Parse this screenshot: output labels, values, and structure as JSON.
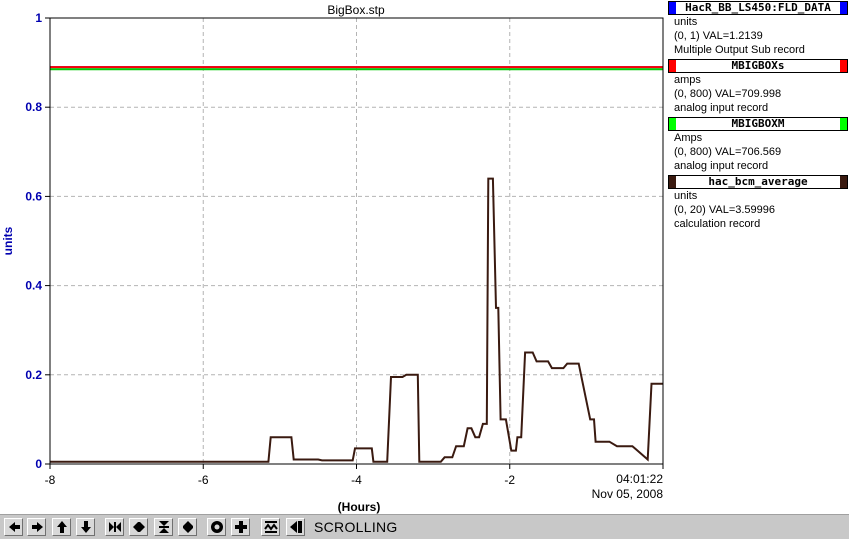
{
  "chart_data": {
    "type": "line",
    "title": "BigBox.stp",
    "ylabel": "units",
    "xlabel": "(Hours)",
    "xlim": [
      -8,
      0
    ],
    "ylim": [
      0,
      1
    ],
    "x_ticks": [
      "-8",
      "-6",
      "-4",
      "-2"
    ],
    "y_ticks": [
      "0",
      "0.2",
      "0.4",
      "0.6",
      "0.8",
      "1"
    ],
    "grid": true,
    "end_time": "04:01:22",
    "end_date": "Nov 05, 2008",
    "series": [
      {
        "name": "HacR_BB_LS450:FLD_DATA",
        "color": "#0000ff",
        "x": [
          -8,
          0
        ],
        "y": [
          0.89,
          0.89
        ]
      },
      {
        "name": "MBIGBOXs",
        "color": "#ff0000",
        "x": [
          -8,
          0
        ],
        "y": [
          0.89,
          0.89
        ]
      },
      {
        "name": "MBIGBOXM",
        "color": "#00cc00",
        "x": [
          -8,
          0
        ],
        "y": [
          0.885,
          0.885
        ]
      },
      {
        "name": "hac_bcm_average",
        "color": "#3a1a10",
        "x": [
          -8,
          -5.15,
          -5.12,
          -4.85,
          -4.82,
          -4.5,
          -4.45,
          -4.05,
          -4.02,
          -3.8,
          -3.78,
          -3.6,
          -3.55,
          -3.4,
          -3.35,
          -3.2,
          -3.18,
          -2.9,
          -2.85,
          -2.75,
          -2.7,
          -2.6,
          -2.55,
          -2.5,
          -2.45,
          -2.4,
          -2.35,
          -2.3,
          -2.28,
          -2.22,
          -2.18,
          -2.15,
          -2.12,
          -2.05,
          -1.98,
          -1.92,
          -1.9,
          -1.85,
          -1.8,
          -1.7,
          -1.65,
          -1.5,
          -1.45,
          -1.3,
          -1.25,
          -1.1,
          -0.95,
          -0.9,
          -0.88,
          -0.7,
          -0.6,
          -0.4,
          -0.2,
          -0.15,
          0
        ],
        "y": [
          0.005,
          0.005,
          0.06,
          0.06,
          0.01,
          0.01,
          0.008,
          0.008,
          0.035,
          0.035,
          0.005,
          0.005,
          0.195,
          0.195,
          0.2,
          0.2,
          0.005,
          0.005,
          0.015,
          0.015,
          0.04,
          0.04,
          0.08,
          0.08,
          0.06,
          0.06,
          0.09,
          0.09,
          0.64,
          0.64,
          0.35,
          0.35,
          0.1,
          0.1,
          0.03,
          0.03,
          0.06,
          0.06,
          0.25,
          0.25,
          0.23,
          0.23,
          0.215,
          0.215,
          0.225,
          0.225,
          0.1,
          0.1,
          0.05,
          0.05,
          0.04,
          0.04,
          0.01,
          0.18,
          0.18
        ]
      }
    ],
    "legend": [
      {
        "name": "HacR_BB_LS450:FLD_DATA",
        "color": "#0000ff",
        "units": "units",
        "reading": "(0, 1) VAL=1.2139",
        "record": "Multiple Output Sub record"
      },
      {
        "name": "MBIGBOXs",
        "color": "#ff0000",
        "units": "amps",
        "reading": "(0, 800) VAL=709.998",
        "record": "analog input record"
      },
      {
        "name": "MBIGBOXM",
        "color": "#00ff00",
        "units": "Amps",
        "reading": "(0, 800) VAL=706.569",
        "record": "analog input record"
      },
      {
        "name": "hac_bcm_average",
        "color": "#3a1a10",
        "units": "units",
        "reading": "(0, 20) VAL=3.59996",
        "record": "calculation record"
      }
    ]
  },
  "toolbar": {
    "status": "SCROLLING",
    "buttons": [
      {
        "icon": "arrow-left-icon"
      },
      {
        "icon": "arrow-right-icon"
      },
      {
        "icon": "arrow-up-icon"
      },
      {
        "icon": "arrow-down-icon"
      },
      {
        "icon": "zoom-in-horizontal-icon"
      },
      {
        "icon": "zoom-out-horizontal-icon"
      },
      {
        "icon": "zoom-in-vertical-icon"
      },
      {
        "icon": "zoom-out-vertical-icon"
      },
      {
        "icon": "reset-icon"
      },
      {
        "icon": "add-icon"
      },
      {
        "icon": "stagger-icon"
      },
      {
        "icon": "scroll-icon"
      }
    ]
  }
}
